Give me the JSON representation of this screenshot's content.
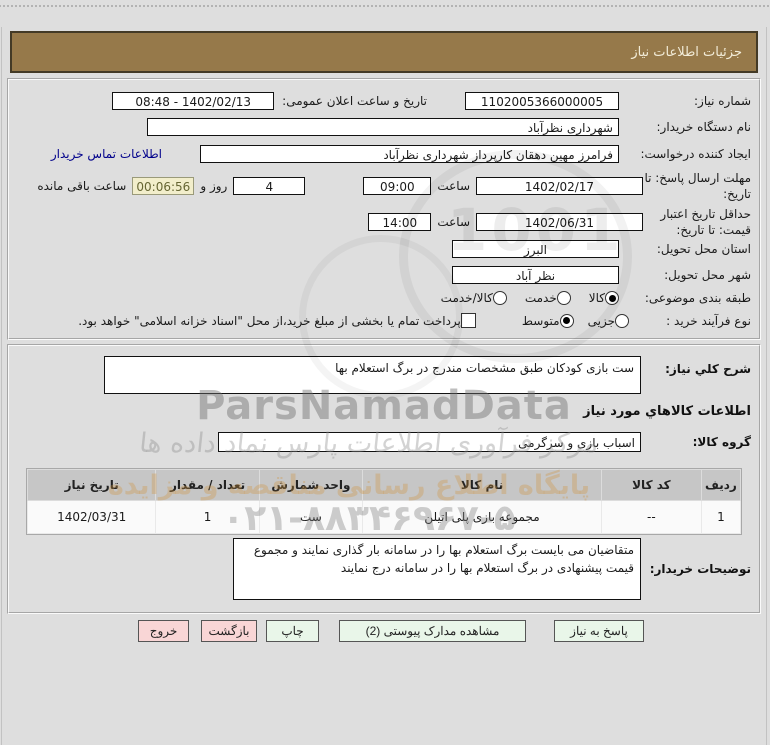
{
  "title_bar": {
    "text": "جزئیات اطلاعات نیاز"
  },
  "info": {
    "need_number": {
      "label": "شماره نیاز:",
      "value": "1102005366000005"
    },
    "announce": {
      "label": "تاریخ و ساعت اعلان عمومی:",
      "value": "08:48 - 1402/02/13"
    },
    "buyer_org": {
      "label": "نام دستگاه خریدار:",
      "value": "شهرداری نظرآباد"
    },
    "creator": {
      "label": "ایجاد کننده درخواست:",
      "value": "فرامرز مهین دهقان کارپرداز شهرداری نظرآباد",
      "contact_link": "اطلاعات تماس خریدار"
    },
    "deadline": {
      "label": "مهلت ارسال پاسخ: تا تاریخ:",
      "date": "1402/02/17",
      "hour_label": "ساعت",
      "hour": "09:00",
      "days": "4",
      "days_label": "روز و",
      "countdown": "00:06:56",
      "countdown_label": "ساعت باقی مانده"
    },
    "price_validity": {
      "label": "حداقل تاریخ اعتبار قیمت: تا تاریخ:",
      "date": "1402/06/31",
      "hour_label": "ساعت",
      "hour": "14:00"
    },
    "province": {
      "label": "استان محل تحویل:",
      "value": "البرز"
    },
    "city": {
      "label": "شهر محل تحویل:",
      "value": "نظر آباد"
    },
    "classification": {
      "label": "طبقه بندی موضوعی:",
      "options": [
        {
          "label": "کالا",
          "selected": true
        },
        {
          "label": "خدمت",
          "selected": false
        },
        {
          "label": "کالا/خدمت",
          "selected": false
        }
      ]
    },
    "process": {
      "label": "نوع فرآیند خرید :",
      "options": [
        {
          "label": "جزیی",
          "selected": false
        },
        {
          "label": "متوسط",
          "selected": true
        }
      ],
      "treasury_note": "پرداخت تمام یا بخشی از مبلغ خرید،از محل \"اسناد خزانه اسلامی\" خواهد بود.",
      "treasury_checked": false
    }
  },
  "need_section": {
    "desc_label": "شرح كلي نیاز:",
    "desc_value": "ست بازی کودکان طبق مشخصات مندرج در برگ استعلام بها",
    "goods_heading": "اطلاعات کالاهاي مورد نیاز",
    "group_label": "گروه کالا:",
    "group_value": "اسباب بازی و سرگرمی",
    "table": {
      "headers": [
        "ردیف",
        "کد کالا",
        "نام کالا",
        "واحد شمارش",
        "تعداد / مقدار",
        "تاریخ نیاز"
      ],
      "rows": [
        [
          "1",
          "--",
          "مجموعه بازی پلی اتیلن",
          "ست",
          "1",
          "1402/03/31"
        ]
      ]
    },
    "notes_label": "توضیحات خریدار:",
    "notes_value": "متقاضیان می بایست برگ استعلام بها را در سامانه بار گذاری نمایند و مجموع قیمت پیشنهادی در برگ استعلام بها را در سامانه درج نمایند"
  },
  "buttons": {
    "respond": "پاسخ به نیاز",
    "attachments": "مشاهده مدارک پیوستی (2)",
    "print": "چاپ",
    "back": "بازگشت",
    "exit": "خروج"
  },
  "watermarks": {
    "brand": "ParsNamadData",
    "calligraphy": "مرکز فرآوری اطلاعات پارس نماد داده ها",
    "slogan": "پایگاه اطلاع رسانی مناقصه و مزایده",
    "phone": "۰۲۱-۸۸۳۴۶۹۶۷-۵",
    "badge_digits": "1001"
  },
  "colors": {
    "header_bg": "#96794a",
    "header_text": "#f2ecd8",
    "link": "#00008b",
    "countdown_bg": "#f2eecb",
    "green_button_bg": "#e9f6e9",
    "pink_button_bg": "#f9d6d6",
    "table_header_bg": "#c6c6c6"
  }
}
